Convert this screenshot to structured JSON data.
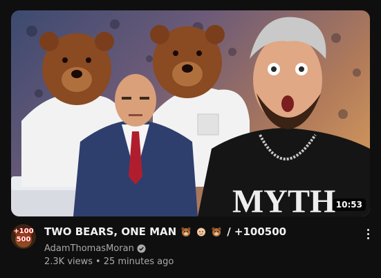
{
  "video": {
    "title": "TWO BEARS, ONE MAN",
    "title_suffix": "/ +100500",
    "title_emojis": [
      "bear-face-icon",
      "person-face-icon",
      "bear-face-icon"
    ],
    "duration": "10:53",
    "thumbnail_text": "MYTH",
    "channel": {
      "name": "AdamThomasMoran",
      "verified": true,
      "avatar_text": "+100 500"
    },
    "views": "2.3K views",
    "separator": "•",
    "published": "25 minutes ago"
  },
  "colors": {
    "background": "#0f0f0f",
    "primary_text": "#f1f1f1",
    "secondary_text": "#aaaaaa"
  }
}
